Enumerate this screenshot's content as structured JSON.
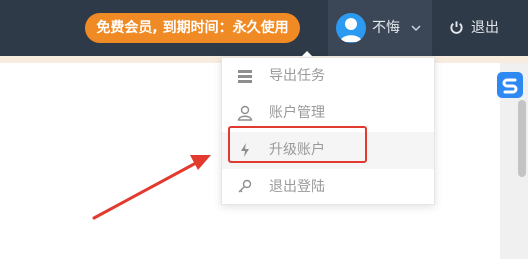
{
  "header": {
    "member_badge": "免费会员, 到期时间：永久使用",
    "user": {
      "name": "不悔"
    },
    "logout_label": "退出"
  },
  "dropdown": {
    "items": [
      {
        "label": "导出任务",
        "icon": "export-list-icon"
      },
      {
        "label": "账户管理",
        "icon": "user-icon"
      },
      {
        "label": "升级账户",
        "icon": "lightning-icon"
      },
      {
        "label": "退出登陆",
        "icon": "key-icon"
      }
    ],
    "hovered_item": "升级账户"
  },
  "annotation": {
    "highlight_color": "#e23a2e",
    "arrow_color": "#e23a2e"
  },
  "colors": {
    "topbar": "#2f3a48",
    "badge": "#f08a24",
    "side_badge": "#2f89f3"
  }
}
